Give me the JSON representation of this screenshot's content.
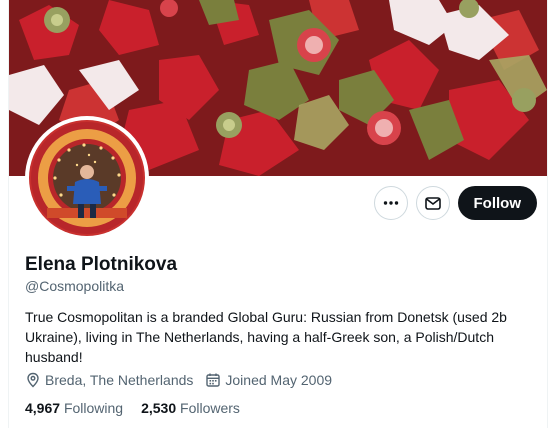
{
  "profile": {
    "name": "Elena Plotnikova",
    "handle": "@Cosmopolitka",
    "bio": "True Cosmopolitan is a branded Global Guru: Russian from Donetsk (used 2b Ukraine), living in The Netherlands, having a half-Greek son, a Polish/Dutch husband!",
    "location": "Breda, The Netherlands",
    "joined": "Joined May 2009",
    "following_count": "4,967",
    "following_label": "Following",
    "followers_count": "2,530",
    "followers_label": "Followers"
  },
  "actions": {
    "more_icon": "more-horizontal-icon",
    "message_icon": "envelope-icon",
    "follow_label": "Follow"
  },
  "icons": {
    "location": "map-pin-icon",
    "joined": "calendar-icon"
  },
  "colors": {
    "follow_bg": "#0f1419",
    "secondary_text": "#536471",
    "border": "#cfd9de"
  }
}
